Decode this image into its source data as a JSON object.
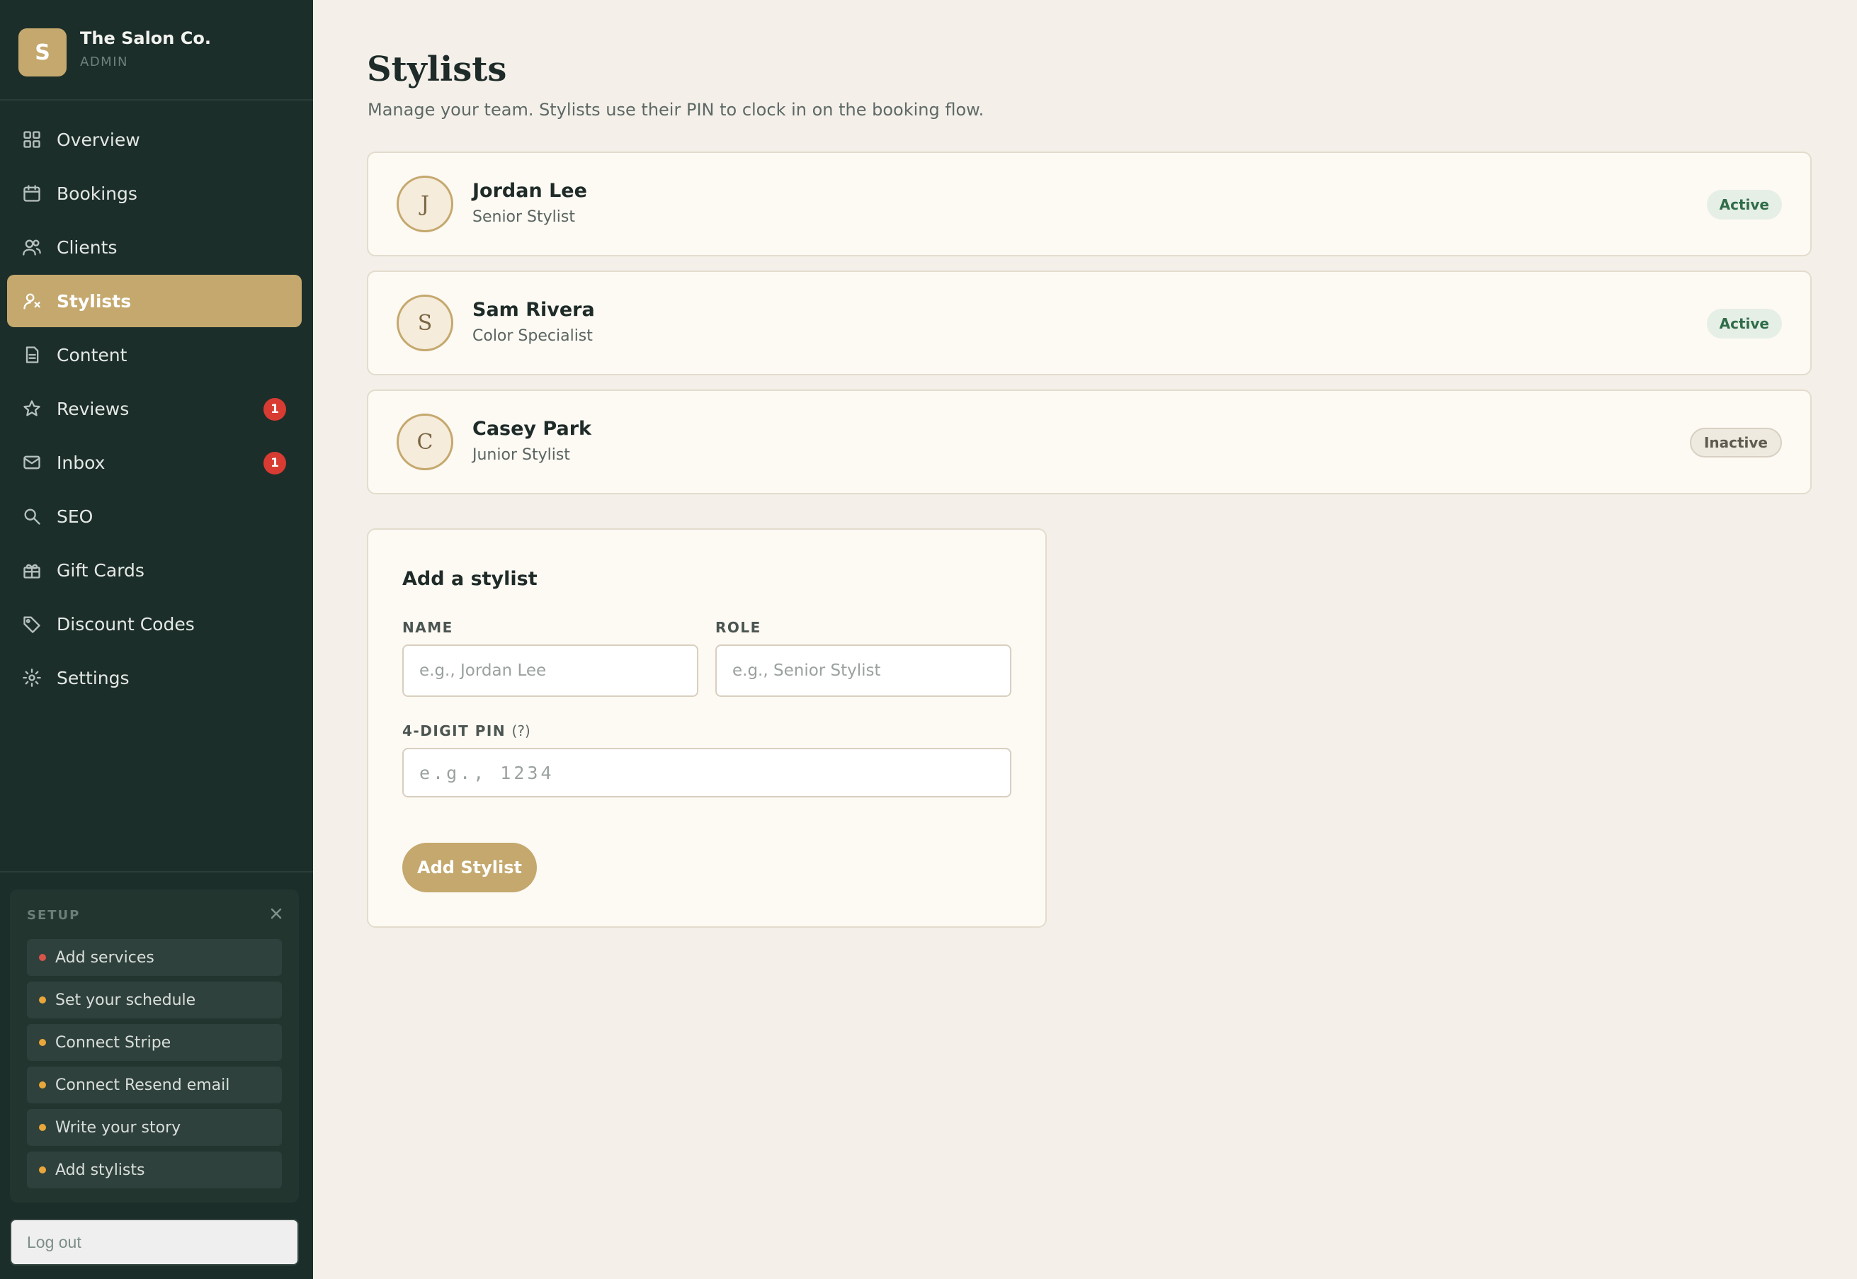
{
  "brand": {
    "initial": "S",
    "name": "The Salon Co.",
    "role": "ADMIN"
  },
  "nav": {
    "items": [
      {
        "label": "Overview",
        "icon": "grid-icon"
      },
      {
        "label": "Bookings",
        "icon": "calendar-icon"
      },
      {
        "label": "Clients",
        "icon": "users-icon"
      },
      {
        "label": "Stylists",
        "icon": "stylist-icon",
        "active": true
      },
      {
        "label": "Content",
        "icon": "document-icon"
      },
      {
        "label": "Reviews",
        "icon": "star-icon",
        "badge": "1"
      },
      {
        "label": "Inbox",
        "icon": "mail-icon",
        "badge": "1"
      },
      {
        "label": "SEO",
        "icon": "search-icon"
      },
      {
        "label": "Gift Cards",
        "icon": "gift-icon"
      },
      {
        "label": "Discount Codes",
        "icon": "tag-icon"
      },
      {
        "label": "Settings",
        "icon": "gear-icon"
      }
    ]
  },
  "setup": {
    "title": "SETUP",
    "items": [
      {
        "label": "Add services",
        "dot_color": "#d9544a"
      },
      {
        "label": "Set your schedule",
        "dot_color": "#e9a73b"
      },
      {
        "label": "Connect Stripe",
        "dot_color": "#e9a73b"
      },
      {
        "label": "Connect Resend email",
        "dot_color": "#e9a73b"
      },
      {
        "label": "Write your story",
        "dot_color": "#e9a73b"
      },
      {
        "label": "Add stylists",
        "dot_color": "#e9a73b"
      }
    ]
  },
  "logout": {
    "label": "Log out"
  },
  "page": {
    "title": "Stylists",
    "subtitle": "Manage your team. Stylists use their PIN to clock in on the booking flow."
  },
  "stylists": [
    {
      "initial": "J",
      "name": "Jordan Lee",
      "role": "Senior Stylist",
      "status": "Active"
    },
    {
      "initial": "S",
      "name": "Sam Rivera",
      "role": "Color Specialist",
      "status": "Active"
    },
    {
      "initial": "C",
      "name": "Casey Park",
      "role": "Junior Stylist",
      "status": "Inactive"
    }
  ],
  "add_form": {
    "title": "Add a stylist",
    "name_label": "NAME",
    "name_placeholder": "e.g., Jordan Lee",
    "role_label": "ROLE",
    "role_placeholder": "e.g., Senior Stylist",
    "pin_label": "4-DIGIT PIN",
    "pin_hint": "(?)",
    "pin_placeholder": "e.g., 1234",
    "submit_label": "Add Stylist"
  },
  "colors": {
    "sidebar_bg": "#1c2e2a",
    "accent": "#c4a86d",
    "page_bg": "#f4f0e9",
    "badge_red": "#d83b32",
    "active_green": "#2f6d49"
  }
}
